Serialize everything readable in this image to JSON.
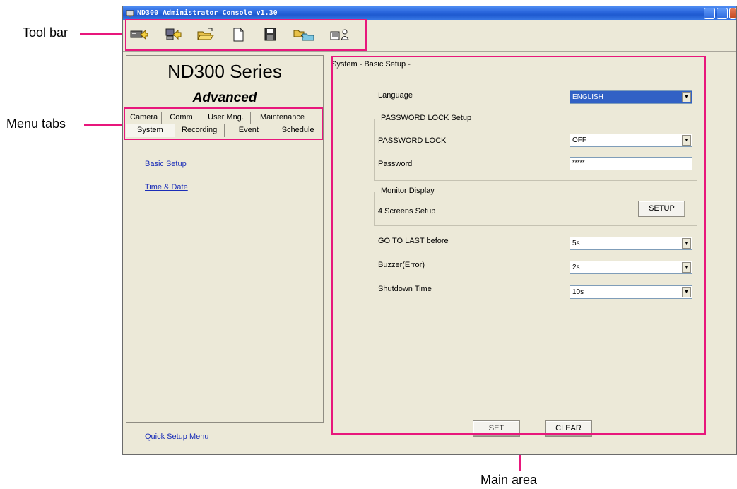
{
  "callouts": {
    "toolbar": "Tool bar",
    "menu_tabs": "Menu tabs",
    "main_area": "Main area"
  },
  "window": {
    "title": "ND300 Administrator Console v1.30"
  },
  "toolbar": {
    "icons": [
      "tv-connect-icon",
      "import-icon",
      "open-folder-icon",
      "new-file-icon",
      "save-icon",
      "folder-copy-icon",
      "user-settings-icon"
    ]
  },
  "left": {
    "series_title": "ND300 Series",
    "series_subtitle": "Advanced",
    "tabs_top": [
      "Camera",
      "Comm",
      "User Mng.",
      "Maintenance"
    ],
    "tabs_bottom": [
      "System",
      "Recording",
      "Event",
      "Schedule"
    ],
    "active_tab": "System",
    "links": [
      "Basic Setup",
      "Time & Date"
    ],
    "quick_setup": "Quick Setup Menu"
  },
  "main": {
    "title": "System - Basic Setup -",
    "language_label": "Language",
    "language_value": "ENGLISH",
    "password_group_title": "PASSWORD LOCK Setup",
    "password_lock_label": "PASSWORD LOCK",
    "password_lock_value": "OFF",
    "password_label": "Password",
    "password_value": "*****",
    "monitor_group_title": "Monitor Display",
    "four_screens_label": "4 Screens Setup",
    "setup_button": "SETUP",
    "goto_last_label": "GO TO LAST before",
    "goto_last_value": "5s",
    "buzzer_label": "Buzzer(Error)",
    "buzzer_value": "2s",
    "shutdown_label": "Shutdown Time",
    "shutdown_value": "10s",
    "set_button": "SET",
    "clear_button": "CLEAR"
  },
  "colors": {
    "callout_accent": "#e8177c",
    "title_bar": "#2a66dc",
    "window_bg": "#ece9d8",
    "link": "#1a2db8",
    "selection": "#3161c5"
  }
}
